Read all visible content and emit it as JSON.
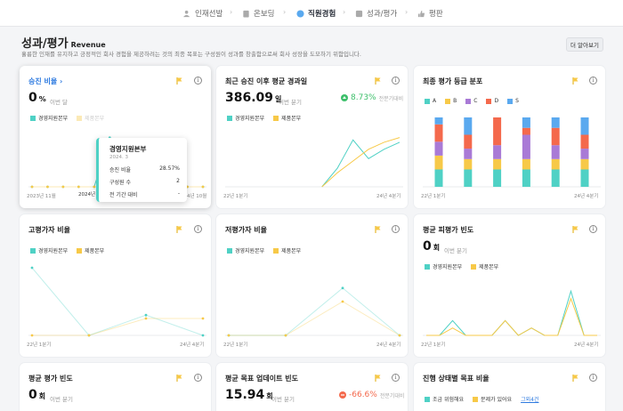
{
  "nav": {
    "steps": [
      {
        "label": "인재선발",
        "icon": "people-icon"
      },
      {
        "label": "온보딩",
        "icon": "clipboard-icon"
      },
      {
        "label": "직원경험",
        "icon": "smile-icon"
      },
      {
        "label": "성과/평가",
        "icon": "chart-icon"
      },
      {
        "label": "평판",
        "icon": "thumbs-up-icon"
      }
    ],
    "separator": "›"
  },
  "page": {
    "title": "성과/평가",
    "title_en": "Revenue",
    "description": "훌륭한 인재를 유지하고 긍정적인 회사 경험을 제공하려는 것의 최종 목표는 구성원이 성과를 창출함으로써 회사 성장을 도모하기 위함입니다.",
    "more_button": "더 알아보기"
  },
  "colors": {
    "teal": "#4fd1c5",
    "yellow": "#f7c948",
    "green": "#8bc34a",
    "orange": "#f08a5d",
    "red": "#f4694c",
    "purple": "#a97ad6",
    "blue": "#5aa9ef"
  },
  "cards": {
    "c1": {
      "title": "승진 비율",
      "value": "0",
      "unit": "%",
      "period": "이번 달",
      "legend": [
        "경영지원본부",
        "제품본부"
      ],
      "x_start": "2023년 11월",
      "x_mid": "2024년",
      "x_end": "4년 10월"
    },
    "c2": {
      "title": "최근 승진 이후 평균 경과일",
      "value": "386.09",
      "unit": "일",
      "period": "이번 분기",
      "change": "8.73%",
      "change_sub": "전분기대비",
      "legend": [
        "경영지원본부",
        "제품본부"
      ],
      "x_start": "22년 1분기",
      "x_end": "24년 4분기"
    },
    "c3": {
      "title": "최종 평가 등급 분포",
      "legend": [
        "A",
        "B",
        "C",
        "D",
        "S"
      ],
      "x_start": "22년 1분기",
      "x_end": "24년 4분기"
    },
    "c4": {
      "title": "고평가자 비율",
      "legend": [
        "경영지원본부",
        "제품본부"
      ],
      "x_start": "22년 1분기",
      "x_end": "24년 4분기"
    },
    "c5": {
      "title": "저평가자 비율",
      "legend": [
        "경영지원본부",
        "제품본부"
      ],
      "x_start": "22년 1분기",
      "x_end": "24년 4분기"
    },
    "c6": {
      "title": "평균 피평가 빈도",
      "value": "0",
      "unit": "회",
      "period": "이번 분기",
      "legend": [
        "경영지원본부",
        "제품본부"
      ],
      "x_start": "22년 1분기",
      "x_end": "24년 4분기"
    },
    "c7": {
      "title": "평균 평가 빈도",
      "value": "0",
      "unit": "회",
      "period": "이번 분기"
    },
    "c8": {
      "title": "평균 목표 업데이트 빈도",
      "value": "15.94",
      "unit": "회",
      "period": "이번 분기",
      "change": "-66.6%",
      "change_sub": "전분기대비"
    },
    "c9": {
      "title": "진행 상태별 목표 비율",
      "legend": [
        "조금 위험해요",
        "문제가 있어요"
      ],
      "legend_link": "그외4건"
    }
  },
  "tooltip": {
    "title": "경영지원본부",
    "date": "2024. 3",
    "rows": [
      {
        "label": "승진 비율",
        "value": "28.57%"
      },
      {
        "label": "구성원 수",
        "value": "2"
      },
      {
        "label": "전 기간 대비",
        "value": "-"
      }
    ]
  },
  "chart_data": [
    {
      "type": "line",
      "title": "승진 비율",
      "series": [
        {
          "name": "경영지원본부",
          "values": [
            0,
            0,
            0,
            0,
            0,
            28.57,
            0,
            0,
            0,
            0,
            0,
            0
          ]
        },
        {
          "name": "제품본부",
          "values": [
            0,
            0,
            0,
            0,
            0,
            0,
            0,
            0,
            0,
            0,
            0,
            0
          ]
        }
      ]
    },
    {
      "type": "line",
      "title": "최근 승진 이후 평균 경과일",
      "series": [
        {
          "name": "경영지원본부",
          "values": [
            null,
            null,
            null,
            null,
            null,
            null,
            0,
            40,
            100,
            60,
            80,
            95
          ]
        },
        {
          "name": "제품본부",
          "values": [
            null,
            null,
            null,
            null,
            null,
            null,
            0,
            30,
            55,
            80,
            95,
            105
          ]
        }
      ]
    },
    {
      "type": "bar",
      "title": "최종 평가 등급 분포",
      "categories": [
        "1",
        "2",
        "3",
        "4",
        "5",
        "6"
      ],
      "series": [
        {
          "name": "A",
          "values": [
            25,
            25,
            25,
            25,
            25,
            25
          ]
        },
        {
          "name": "B",
          "values": [
            20,
            15,
            15,
            15,
            15,
            15
          ]
        },
        {
          "name": "C",
          "values": [
            20,
            15,
            20,
            35,
            20,
            15
          ]
        },
        {
          "name": "D",
          "values": [
            25,
            20,
            40,
            10,
            25,
            20
          ]
        },
        {
          "name": "S",
          "values": [
            10,
            25,
            0,
            15,
            15,
            25
          ]
        }
      ]
    },
    {
      "type": "line",
      "title": "고평가자 비율",
      "series": [
        {
          "name": "경영지원본부",
          "values": [
            100,
            0,
            30,
            0
          ]
        },
        {
          "name": "제품본부",
          "values": [
            0,
            0,
            25,
            25
          ]
        }
      ]
    },
    {
      "type": "line",
      "title": "저평가자 비율",
      "series": [
        {
          "name": "경영지원본부",
          "values": [
            0,
            0,
            70,
            0
          ]
        },
        {
          "name": "제품본부",
          "values": [
            0,
            0,
            50,
            0
          ]
        }
      ]
    },
    {
      "type": "line",
      "title": "평균 피평가 빈도",
      "series": [
        {
          "name": "경영지원본부",
          "values": [
            0,
            0,
            2,
            0,
            0,
            0,
            2,
            0,
            1,
            0,
            0,
            6,
            0,
            0
          ]
        },
        {
          "name": "제품본부",
          "values": [
            0,
            0,
            1,
            0,
            0,
            0,
            2,
            0,
            1,
            0,
            0,
            5,
            0,
            0
          ]
        }
      ]
    }
  ]
}
